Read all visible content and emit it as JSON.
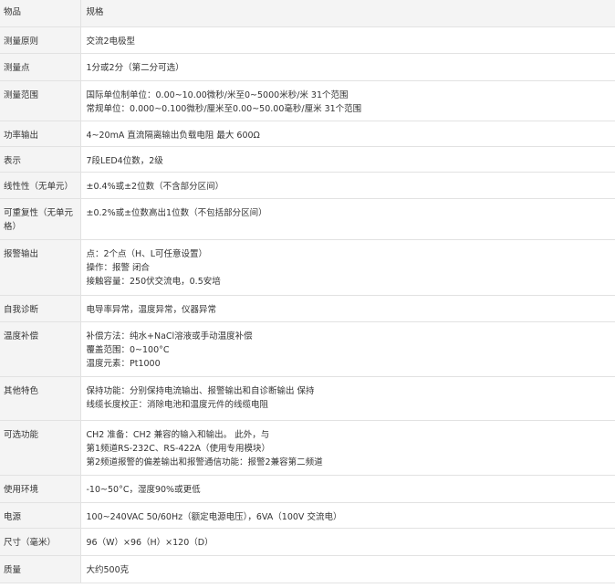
{
  "header": {
    "item": "物品",
    "spec": "规格"
  },
  "rows": [
    {
      "label": "测量原则",
      "lines": [
        "交流2电极型"
      ]
    },
    {
      "label": "测量点",
      "lines": [
        "1分或2分（第二分可选）"
      ]
    },
    {
      "label": "测量范围",
      "lines": [
        "国际单位制单位：0.00~10.00微秒/米至0~5000米秒/米 31个范围",
        "常规单位：0.000~0.100微秒/厘米至0.00~50.00毫秒/厘米 31个范围"
      ]
    },
    {
      "label": "功率输出",
      "lines": [
        "4~20mA 直流隔离输出负载电阻 最大 600Ω"
      ]
    },
    {
      "label": "表示",
      "lines": [
        "7段LED4位数，2级"
      ]
    },
    {
      "label": "线性性（无单元）",
      "lines": [
        "±0.4%或±2位数（不含部分区间）"
      ]
    },
    {
      "label": "可重复性（无单元格）",
      "lines": [
        "±0.2%或±位数高出1位数（不包括部分区间）"
      ]
    },
    {
      "label": "报警输出",
      "lines": [
        "点：2个点（H、L可任意设置）",
        "操作：报警 闭合",
        "接触容量：250伏交流电，0.5安培"
      ]
    },
    {
      "label": "自我诊断",
      "lines": [
        "电导率异常，温度异常，仪器异常"
      ]
    },
    {
      "label": "温度补偿",
      "lines": [
        "补偿方法：纯水+NaCl溶液或手动温度补偿",
        "覆盖范围：0~100°C",
        "温度元素：Pt1000"
      ]
    },
    {
      "label": "其他特色",
      "lines": [
        "保持功能：分别保持电流输出、报警输出和自诊断输出 保持",
        "线缆长度校正：消除电池和温度元件的线缆电阻"
      ]
    },
    {
      "label": "可选功能",
      "lines": [
        "CH2 准备：CH2 兼容的输入和输出。 此外，与",
        "第1频道RS-232C、RS-422A（使用专用模块）",
        "第2频道报警的偏差输出和报警通信功能：报警2兼容第二频道"
      ]
    },
    {
      "label": "使用环境",
      "lines": [
        "-10~50°C，湿度90%或更低"
      ]
    },
    {
      "label": "电源",
      "lines": [
        "100~240VAC 50/60Hz（额定电源电压），6VA（100V 交流电）"
      ]
    },
    {
      "label": "尺寸（毫米）",
      "lines": [
        "96（W）×96（H）×120（D）"
      ]
    },
    {
      "label": "质量",
      "lines": [
        "大约500克"
      ]
    }
  ]
}
